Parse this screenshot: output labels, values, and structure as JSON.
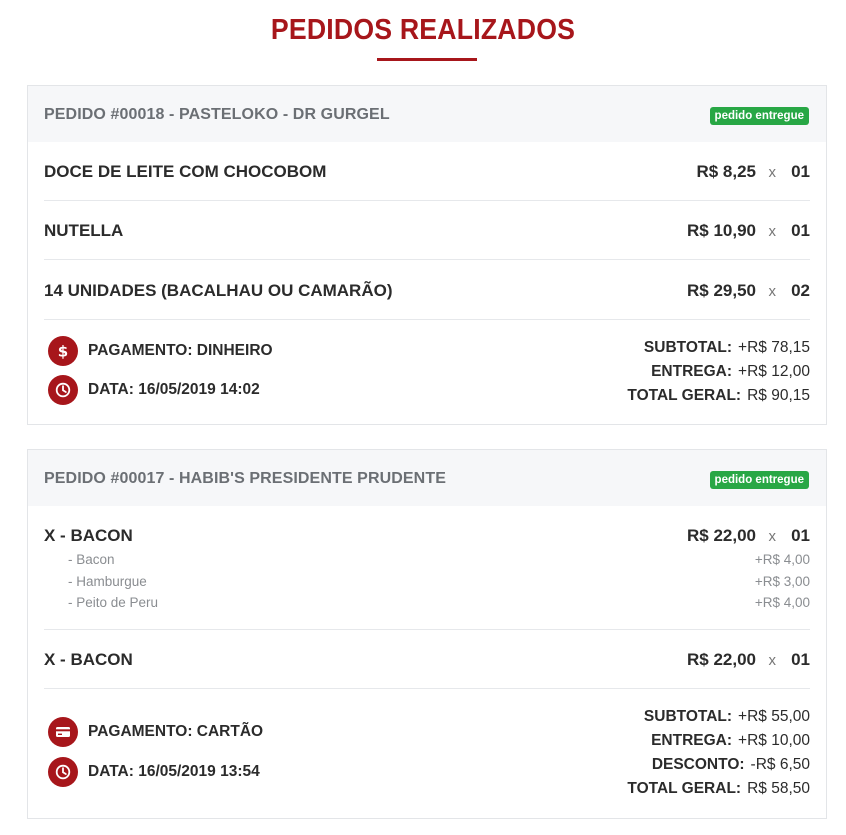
{
  "page": {
    "title": "PEDIDOS REALIZADOS"
  },
  "orders": [
    {
      "title": "PEDIDO #00018 - PASTELOKO - DR GURGEL",
      "status": "pedido entregue",
      "items": [
        {
          "name": "DOCE DE LEITE COM CHOCOBOM",
          "price": "R$ 8,25",
          "x": "x",
          "qty": "01"
        },
        {
          "name": "NUTELLA",
          "price": "R$ 10,90",
          "x": "x",
          "qty": "01"
        },
        {
          "name": "14 UNIDADES (BACALHAU OU CAMARÃO)",
          "price": "R$ 29,50",
          "x": "x",
          "qty": "02"
        }
      ],
      "payment": "PAGAMENTO: DINHEIRO",
      "date": "DATA: 16/05/2019 14:02",
      "totals": [
        {
          "label": "SUBTOTAL:",
          "value": "+R$ 78,15"
        },
        {
          "label": "ENTREGA:",
          "value": "+R$ 12,00"
        },
        {
          "label": "TOTAL GERAL:",
          "value": "R$ 90,15"
        }
      ]
    },
    {
      "title": "PEDIDO #00017 - HABIB'S PRESIDENTE PRUDENTE",
      "status": "pedido entregue",
      "items": [
        {
          "name": "X - BACON",
          "price": "R$ 22,00",
          "x": "x",
          "qty": "01",
          "addons": [
            {
              "name": "- Bacon",
              "price": "+R$ 4,00"
            },
            {
              "name": "- Hamburgue",
              "price": "+R$ 3,00"
            },
            {
              "name": "- Peito de Peru",
              "price": "+R$ 4,00"
            }
          ]
        },
        {
          "name": "X - BACON",
          "price": "R$ 22,00",
          "x": "x",
          "qty": "01"
        }
      ],
      "payment": "PAGAMENTO: CARTÃO",
      "date": "DATA: 16/05/2019 13:54",
      "totals": [
        {
          "label": "SUBTOTAL:",
          "value": "+R$ 55,00"
        },
        {
          "label": "ENTREGA:",
          "value": "+R$ 10,00"
        },
        {
          "label": "DESCONTO:",
          "value": "-R$ 6,50"
        },
        {
          "label": "TOTAL GERAL:",
          "value": "R$ 58,50"
        }
      ]
    }
  ],
  "icons": {
    "payment_cash": "dollar-icon",
    "payment_card": "credit-card-icon",
    "date": "clock-icon"
  },
  "colors": {
    "accent": "#a7161b",
    "status": "#28a745"
  }
}
